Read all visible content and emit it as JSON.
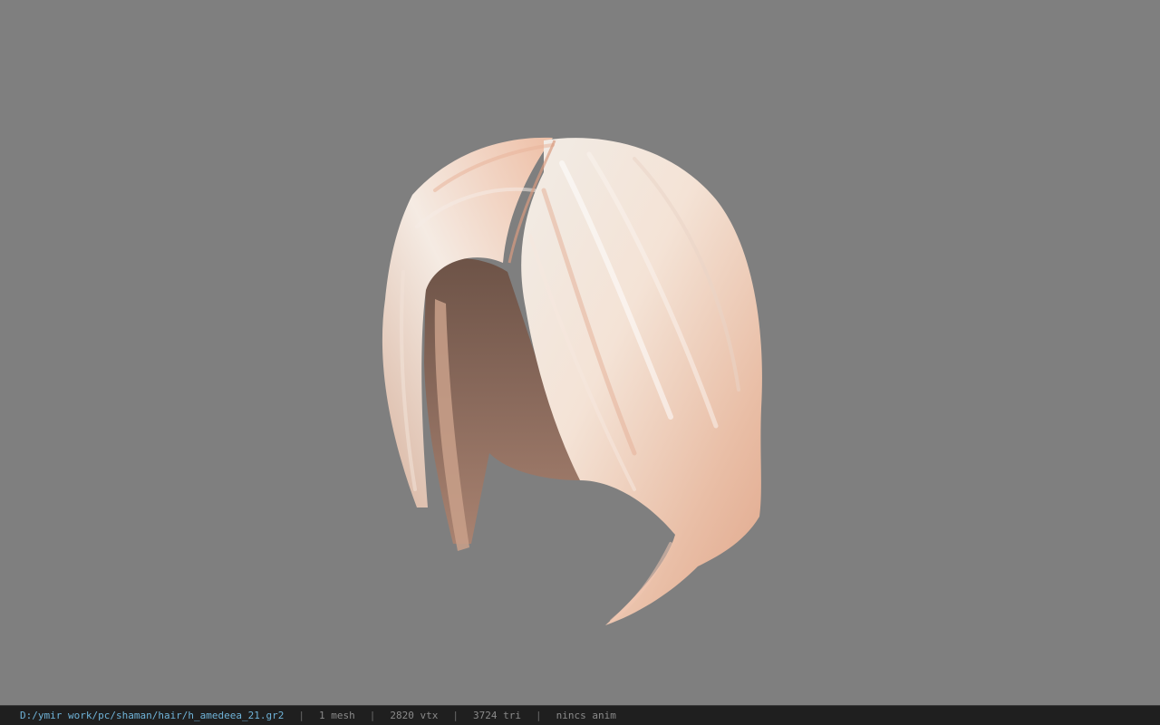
{
  "viewport": {
    "background_color": "#7f7f7f",
    "model_name": "hair-mesh-model"
  },
  "statusbar": {
    "file_path": "D:/ymir work/pc/shaman/hair/h_amedeea_21.gr2",
    "separator": "|",
    "mesh_count": "1 mesh",
    "vertex_count": "2820 vtx",
    "triangle_count": "3724 tri",
    "anim_status": "nincs anim",
    "path_color": "#6fb3d8",
    "text_color": "#8a8a8a"
  }
}
